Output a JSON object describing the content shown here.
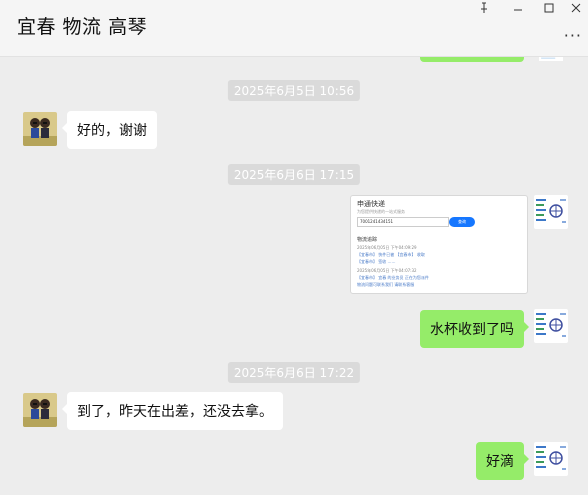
{
  "window": {
    "title": "宜春 物流 高琴",
    "controls": [
      "pin-icon",
      "minimize-icon",
      "maximize-icon",
      "close-icon"
    ],
    "more_label": "···"
  },
  "colors": {
    "background": "#ededed",
    "incoming_bubble": "#ffffff",
    "outgoing_bubble": "#95ec69",
    "time_pill": "#dadada"
  },
  "messages": {
    "t1": "2025年6月5日 10:56",
    "m1": "好的，谢谢",
    "t2": "2025年6月6日 17:15",
    "m3": "水杯收到了吗",
    "t3": "2025年6月6日 17:22",
    "m4": "到了，昨天在出差，还没去拿。",
    "m5": "好滴"
  },
  "screenshot": {
    "title": "申通快递",
    "subtitle": "为您提供快递的一站式服务",
    "tracking_no": "7001241434151",
    "query_btn": "查询",
    "track_label": "物流追踪",
    "lines": [
      "2025年06月05日 下午04:09:29",
      "【宜春市】 快件已被 【宜春市】 收取",
      "【宜春市】 签收 ……",
      "2025年06月05日 下午04:07:32",
      "【宜春市】 宜春 的业务员 正在为您派件",
      "物流问题可联系我们 请联系客服"
    ]
  }
}
